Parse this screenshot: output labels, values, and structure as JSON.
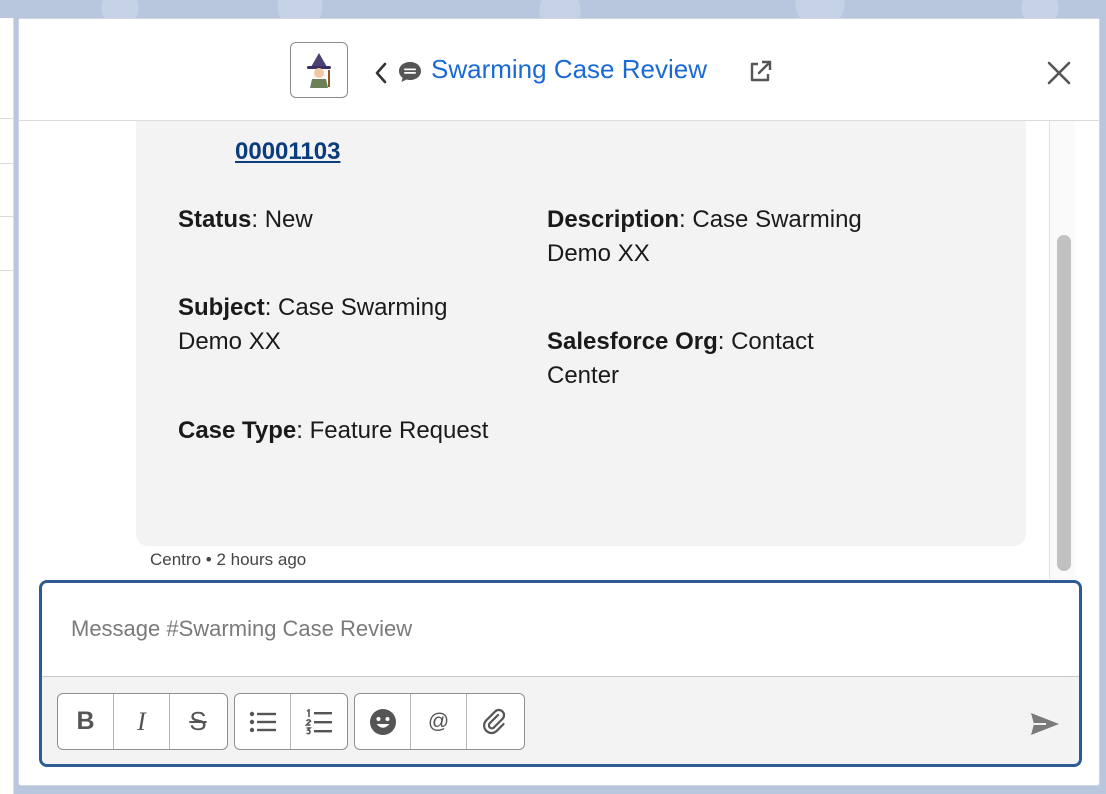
{
  "header": {
    "title": "Swarming Case Review"
  },
  "case": {
    "number": "00001103",
    "fields": [
      {
        "label": "Status",
        "value": "New"
      },
      {
        "label": "Description",
        "value": "Case Swarming"
      },
      {
        "label": "Description_cont",
        "value": "Demo XX"
      },
      {
        "label": "Subject",
        "value": "Case Swarming"
      },
      {
        "label": "Subject_cont",
        "value": "Demo XX"
      },
      {
        "label": "Salesforce Org",
        "value": "Contact"
      },
      {
        "label": "Salesforce Org_cont",
        "value": "Center"
      },
      {
        "label": "Case Type",
        "value": "Feature Request"
      }
    ]
  },
  "message_meta": {
    "author": "Centro",
    "separator": "•",
    "time": "2 hours ago"
  },
  "composer": {
    "placeholder": "Message #Swarming Case Review"
  },
  "toolbar": {
    "bold": "B",
    "italic": "I",
    "strike": "S",
    "mention": "@"
  },
  "labels": {
    "status": "Status",
    "description": "Description",
    "subject": "Subject",
    "salesforce_org": "Salesforce Org",
    "case_type": "Case Type",
    "colon": ":"
  },
  "values": {
    "status": "New",
    "description_line1": "Case Swarming",
    "description_line2": "Demo XX",
    "subject_line1": "Case Swarming",
    "subject_line2": "Demo XX",
    "salesforce_org_line1": "Contact",
    "salesforce_org_line2": "Center",
    "case_type": "Feature Request"
  }
}
